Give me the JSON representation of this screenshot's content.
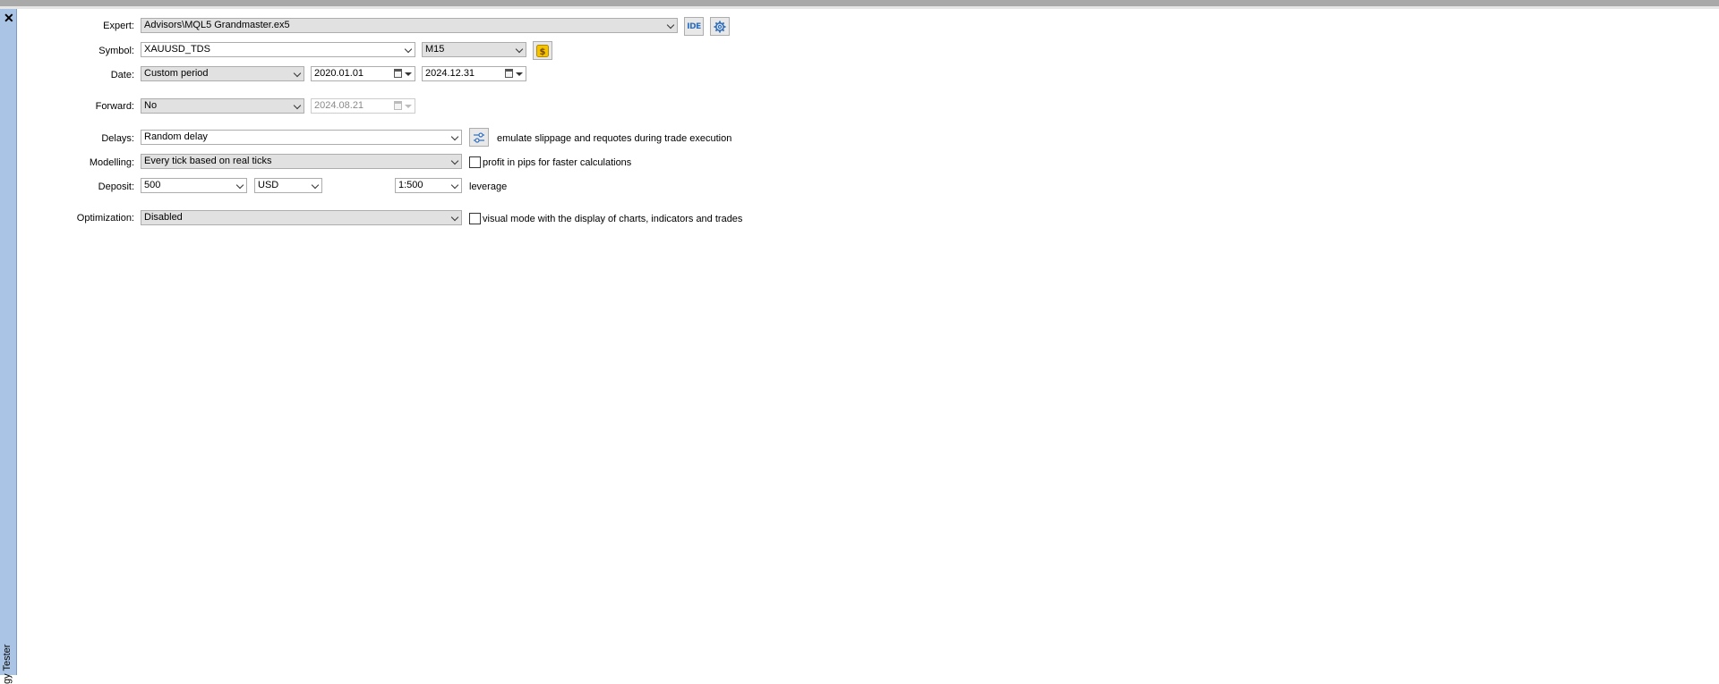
{
  "side_panel": {
    "close_glyph": "✕",
    "title": "gy Tester"
  },
  "form": {
    "expert": {
      "label": "Expert:",
      "value": "Advisors\\MQL5 Grandmaster.ex5",
      "ide_button": "IDE",
      "settings_icon": "gear-icon"
    },
    "symbol": {
      "label": "Symbol:",
      "value": "XAUUSD_TDS",
      "timeframe": "M15",
      "symbol_icon": "dollar-icon"
    },
    "date": {
      "label": "Date:",
      "period": "Custom period",
      "from": "2020.01.01",
      "to": "2024.12.31"
    },
    "forward": {
      "label": "Forward:",
      "value": "No",
      "date": "2024.08.21"
    },
    "delays": {
      "label": "Delays:",
      "value": "Random delay",
      "description": "emulate slippage and requotes during trade execution"
    },
    "modelling": {
      "label": "Modelling:",
      "value": "Every tick based on real ticks",
      "checkbox_label": "profit in pips for faster calculations",
      "checked": false
    },
    "deposit": {
      "label": "Deposit:",
      "amount": "500",
      "currency": "USD",
      "leverage": "1:500",
      "leverage_label": "leverage"
    },
    "optimization": {
      "label": "Optimization:",
      "value": "Disabled",
      "checkbox_label": "visual mode with the display of charts, indicators and trades",
      "checked": false
    }
  },
  "colors": {
    "side_panel": "#a9c4e4",
    "accent_blue": "#2f6fbf",
    "symbol_button": "#f5c400"
  }
}
